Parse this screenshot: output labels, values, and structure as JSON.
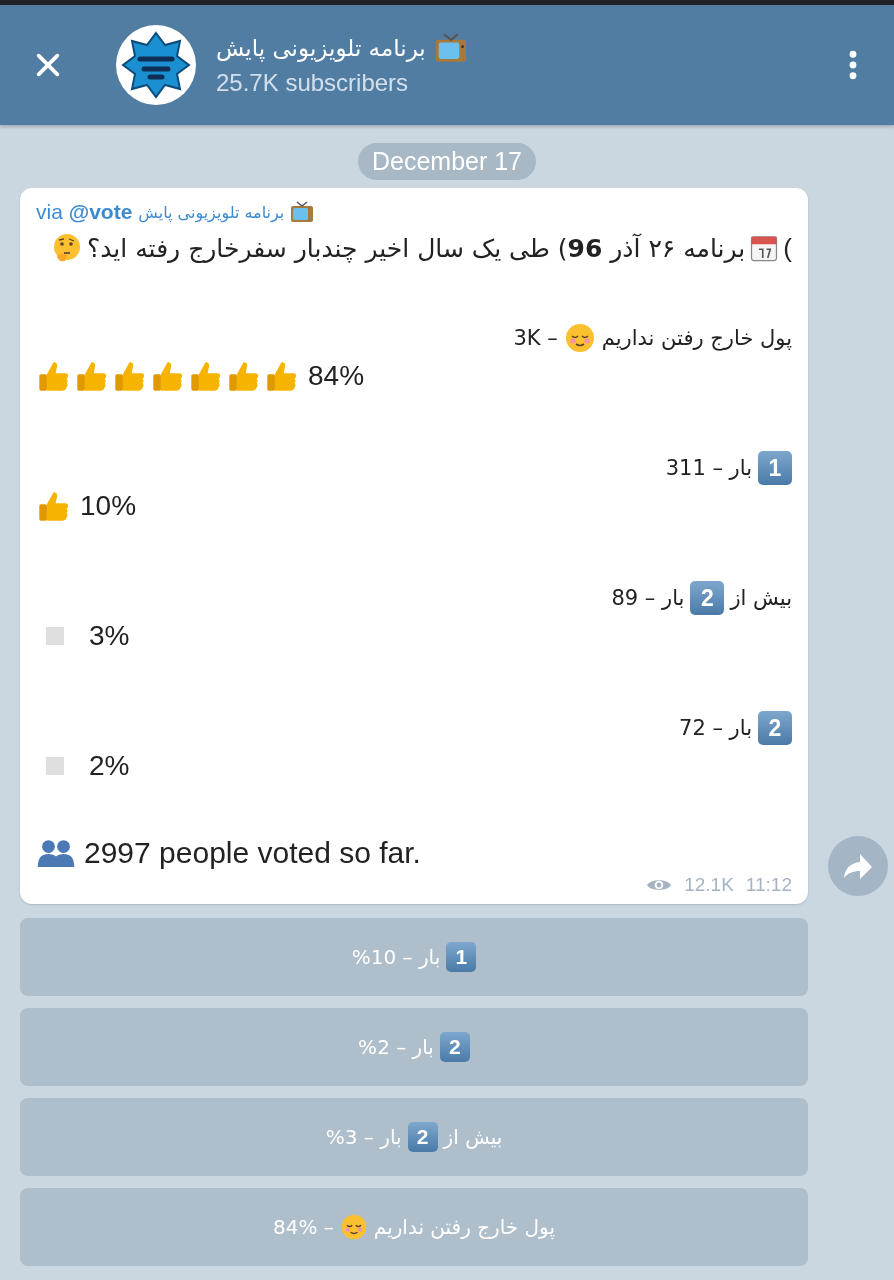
{
  "header": {
    "title": "برنامه تلویزیونی پایش",
    "subtitle": "25.7K subscribers"
  },
  "date": "December 17",
  "message": {
    "via": "via **@vote**",
    "via_channel": "برنامه تلویزیونی پایش",
    "question_open": "(",
    "question": "برنامه ۲۶ آذر **96**) طی یک سال اخیر چندبار سفرخارج رفته اید؟",
    "options": [
      {
        "segments": [
          {
            "kind": "text",
            "text": "پول خارج رفتن نداریم"
          },
          {
            "kind": "face"
          },
          {
            "kind": "text",
            "text": "– 3K"
          }
        ],
        "bar": [
          {
            "kind": "thumb"
          },
          {
            "kind": "thumb"
          },
          {
            "kind": "thumb"
          },
          {
            "kind": "thumb"
          },
          {
            "kind": "thumb"
          },
          {
            "kind": "thumb"
          },
          {
            "kind": "thumb"
          }
        ],
        "percent": "84%"
      },
      {
        "segments": [
          {
            "kind": "keycap",
            "text": "1"
          },
          {
            "kind": "text",
            "text": "بار – 311"
          }
        ],
        "bar": [
          {
            "kind": "thumb"
          }
        ],
        "percent": "10%"
      },
      {
        "segments": [
          {
            "kind": "text",
            "text": "بیش از"
          },
          {
            "kind": "keycap",
            "text": "2"
          },
          {
            "kind": "text",
            "text": "بار – 89"
          }
        ],
        "bar": [
          {
            "kind": "square"
          }
        ],
        "percent": "3%"
      },
      {
        "segments": [
          {
            "kind": "keycap",
            "text": "2"
          },
          {
            "kind": "text",
            "text": "بار – 72"
          }
        ],
        "bar": [
          {
            "kind": "square"
          }
        ],
        "percent": "2%"
      }
    ],
    "footer": "2997 people voted so far.",
    "views": "12.1K",
    "time": "11:12"
  },
  "buttons": [
    {
      "segments": [
        {
          "kind": "keycap",
          "text": "1"
        },
        {
          "kind": "text",
          "text": "بار – 10%"
        }
      ]
    },
    {
      "segments": [
        {
          "kind": "keycap",
          "text": "2"
        },
        {
          "kind": "text",
          "text": "بار – 2%"
        }
      ]
    },
    {
      "segments": [
        {
          "kind": "text",
          "text": "بیش از"
        },
        {
          "kind": "keycap",
          "text": "2"
        },
        {
          "kind": "text",
          "text": "بار – 3%"
        }
      ]
    },
    {
      "segments": [
        {
          "kind": "text",
          "text": "پول خارج رفتن نداریم"
        },
        {
          "kind": "face"
        },
        {
          "kind": "text",
          "text": "– 84%"
        }
      ]
    }
  ]
}
